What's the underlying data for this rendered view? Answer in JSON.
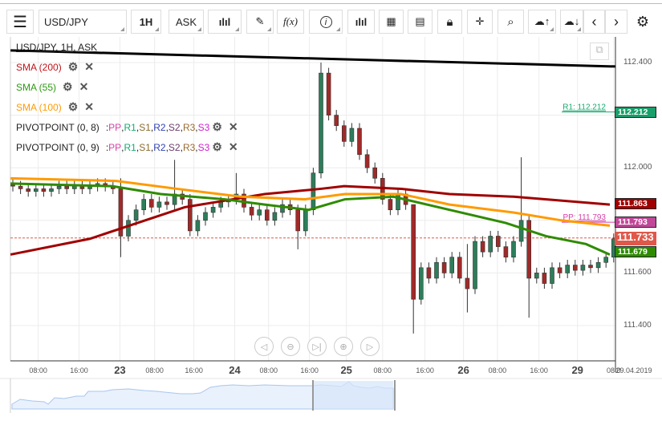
{
  "toolbar": {
    "symbol": "USD/JPY",
    "interval": "1H",
    "price_type": "ASK",
    "icons": [
      "menu-icon",
      "candles-icon",
      "pencil-icon",
      "function-icon",
      "info-icon",
      "bar-volume-icon",
      "calendar-icon",
      "document-icon",
      "lock-icon",
      "crosshair-icon",
      "zoom-chart-icon",
      "upload-icon",
      "download-icon",
      "chevron-left-icon",
      "chevron-right-icon",
      "gear-icon"
    ],
    "fx_label": "f(x)"
  },
  "legend": {
    "title": "USD/JPY, 1H, ASK",
    "sma": [
      {
        "label": "SMA (200)",
        "color": "#c0131a"
      },
      {
        "label": "SMA (55)",
        "color": "#2a9a10"
      },
      {
        "label": "SMA (100)",
        "color": "#ff9a00"
      }
    ],
    "pivots": [
      {
        "label": "PIVOTPOINT (0, 8)"
      },
      {
        "label": "PIVOTPOINT (0, 9)"
      }
    ],
    "pivot_parts": [
      {
        "t": "PP",
        "c": "#d63fa8"
      },
      {
        "t": "R1",
        "c": "#18a870"
      },
      {
        "t": "S1",
        "c": "#8a6a2a"
      },
      {
        "t": "R2",
        "c": "#3040b0"
      },
      {
        "t": "S2",
        "c": "#6a3a6a"
      },
      {
        "t": "R3",
        "c": "#9a6a30"
      },
      {
        "t": "S3",
        "c": "#d020d0"
      }
    ],
    "sep": ": "
  },
  "chart_data": {
    "type": "candlestick",
    "ylim": [
      111.3,
      112.5
    ],
    "y_ticks": [
      "112.400",
      "112.000",
      "111.600",
      "111.400"
    ],
    "y_tick_values": [
      112.4,
      112.0,
      111.6,
      111.4
    ],
    "x_labels": [
      {
        "t": "08:00",
        "i": 3.3
      },
      {
        "t": "16:00",
        "i": 8.6
      },
      {
        "t": "23",
        "i": 13.9,
        "big": true
      },
      {
        "t": "08:00",
        "i": 18.4
      },
      {
        "t": "16:00",
        "i": 23.5
      },
      {
        "t": "24",
        "i": 28.8,
        "big": true
      },
      {
        "t": "08:00",
        "i": 33.2
      },
      {
        "t": "16:00",
        "i": 38.5
      },
      {
        "t": "25",
        "i": 43.3,
        "big": true
      },
      {
        "t": "08:00",
        "i": 48
      },
      {
        "t": "16:00",
        "i": 53.5
      },
      {
        "t": "26",
        "i": 58.5,
        "big": true
      },
      {
        "t": "08:00",
        "i": 62.9
      },
      {
        "t": "16:00",
        "i": 68.3
      },
      {
        "t": "29",
        "i": 73.3,
        "big": true
      },
      {
        "t": "08:0",
        "i": 78
      }
    ],
    "date_label": "29.04.2019",
    "first_open": 111.94,
    "closes": [
      111.93,
      111.92,
      111.91,
      111.92,
      111.91,
      111.92,
      111.93,
      111.92,
      111.93,
      111.92,
      111.93,
      111.94,
      111.93,
      111.92,
      111.74,
      111.8,
      111.84,
      111.88,
      111.85,
      111.87,
      111.86,
      111.9,
      111.88,
      111.76,
      111.8,
      111.83,
      111.85,
      111.87,
      111.88,
      111.9,
      111.85,
      111.82,
      111.84,
      111.8,
      111.83,
      111.86,
      111.84,
      111.76,
      111.84,
      111.98,
      112.36,
      112.2,
      112.16,
      112.1,
      112.15,
      112.05,
      112.0,
      111.96,
      111.88,
      111.84,
      111.9,
      111.86,
      111.5,
      111.62,
      111.58,
      111.64,
      111.6,
      111.66,
      111.58,
      111.54,
      111.72,
      111.68,
      111.74,
      111.7,
      111.66,
      111.72,
      111.8,
      111.58,
      111.6,
      111.56,
      111.62,
      111.6,
      111.63,
      111.61,
      111.63,
      111.62,
      111.64,
      111.66,
      111.73
    ],
    "highs": {
      "14": 111.96,
      "21": 112.03,
      "29": 111.98,
      "40": 112.4,
      "52": 111.86,
      "66": 112.04,
      "59": 111.71
    },
    "lows": {
      "14": 111.66,
      "37": 111.69,
      "52": 111.37,
      "59": 111.45,
      "67": 111.43,
      "23": 111.74
    },
    "sma": [
      {
        "name": "SMA (200)",
        "color": "#a00000",
        "points": [
          [
            -0.3,
            111.67
          ],
          [
            10,
            111.73
          ],
          [
            22.3,
            111.85
          ],
          [
            32.7,
            111.9
          ],
          [
            40,
            111.92
          ],
          [
            43,
            111.93
          ],
          [
            50.4,
            111.92
          ],
          [
            56.7,
            111.9
          ],
          [
            65,
            111.89
          ],
          [
            77.5,
            111.86
          ]
        ]
      },
      {
        "name": "SMA (100)",
        "color": "#ff9a00",
        "points": [
          [
            -0.3,
            111.96
          ],
          [
            13.4,
            111.95
          ],
          [
            21.3,
            111.92
          ],
          [
            29.6,
            111.89
          ],
          [
            37.9,
            111.88
          ],
          [
            43.1,
            111.9
          ],
          [
            50.4,
            111.9
          ],
          [
            56.7,
            111.86
          ],
          [
            65,
            111.83
          ],
          [
            71.2,
            111.8
          ],
          [
            77.5,
            111.78
          ]
        ]
      },
      {
        "name": "SMA (55)",
        "color": "#2e8b00",
        "points": [
          [
            -0.3,
            111.94
          ],
          [
            12.9,
            111.93
          ],
          [
            19.2,
            111.9
          ],
          [
            27.5,
            111.88
          ],
          [
            32.7,
            111.86
          ],
          [
            38.4,
            111.84
          ],
          [
            43.1,
            111.88
          ],
          [
            49.4,
            111.89
          ],
          [
            56.7,
            111.84
          ],
          [
            64,
            111.79
          ],
          [
            69.2,
            111.74
          ],
          [
            74.4,
            111.71
          ],
          [
            77.5,
            111.67
          ]
        ]
      }
    ],
    "trendline": [
      [
        -0.3,
        112.446
      ],
      [
        78.2,
        112.385
      ]
    ],
    "pivot_levels": [
      {
        "label": "R1: 112.212",
        "value": 112.212,
        "color": "#18a870"
      },
      {
        "label": "PP: 111.793",
        "value": 111.793,
        "color": "#d63fa8"
      }
    ],
    "price_tags": [
      {
        "value": "112.212",
        "num": 112.212,
        "color": "#1a9e6a"
      },
      {
        "value": "111.863",
        "num": 111.863,
        "color": "#a00000"
      },
      {
        "value": "111.793",
        "num": 111.793,
        "color": "#c04898"
      },
      {
        "value": "111.733",
        "num": 111.733,
        "color": "#e0584a"
      },
      {
        "value": "111.679",
        "num": 111.679,
        "color": "#2e8b00"
      }
    ],
    "current_price": 111.733
  },
  "nav_buttons": [
    "◁",
    "⊖",
    "▷|",
    "⊕",
    "▷"
  ]
}
